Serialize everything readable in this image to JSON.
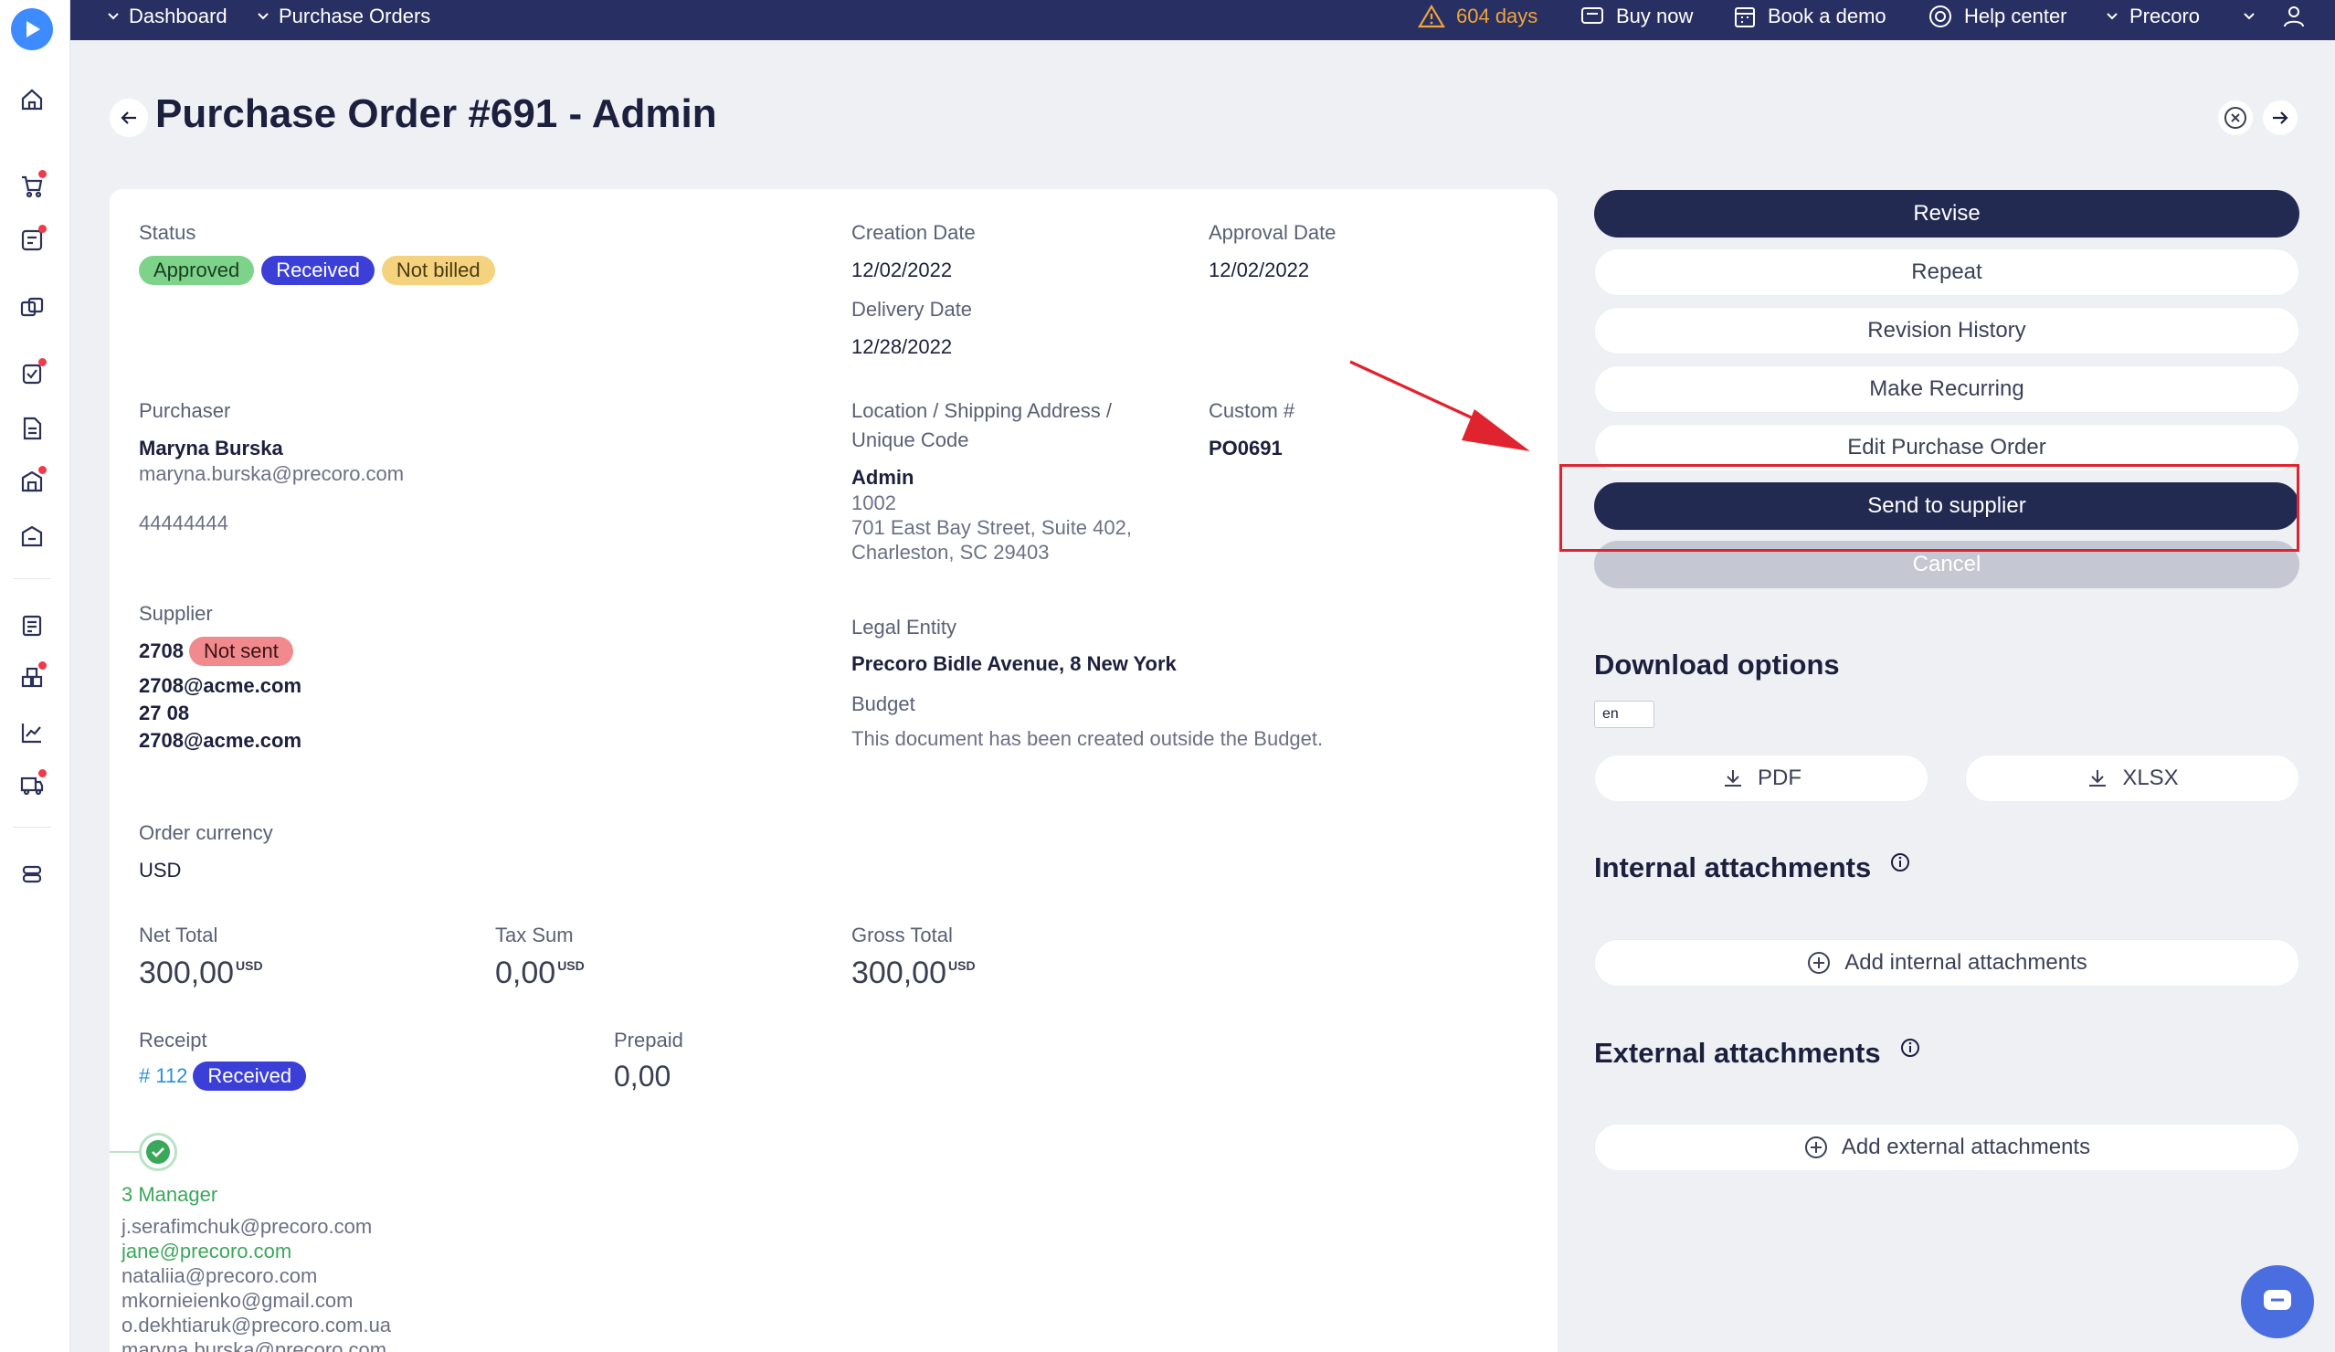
{
  "breadcrumbs": [
    "Dashboard",
    "Purchase Orders"
  ],
  "topbar": {
    "trial": "604 days",
    "buy_now": "Buy now",
    "book_demo": "Book a demo",
    "help_center": "Help center",
    "company": "Precoro"
  },
  "page": {
    "title": "Purchase Order #691 - Admin"
  },
  "details": {
    "status_label": "Status",
    "status_badges": [
      "Approved",
      "Received",
      "Not billed"
    ],
    "creation_date_label": "Creation Date",
    "creation_date": "12/02/2022",
    "approval_date_label": "Approval Date",
    "approval_date": "12/02/2022",
    "delivery_date_label": "Delivery Date",
    "delivery_date": "12/28/2022",
    "purchaser_label": "Purchaser",
    "purchaser_name": "Maryna Burska",
    "purchaser_email": "maryna.burska@precoro.com",
    "purchaser_phone": "44444444",
    "location_label_1": "Location / Shipping Address /",
    "location_label_2": "Unique Code",
    "location_name": "Admin",
    "location_code": "1002",
    "location_address_1": "701 East Bay Street, Suite 402,",
    "location_address_2": "Charleston, SC 29403",
    "custom_label": "Custom #",
    "custom_value": "PO0691",
    "supplier_label": "Supplier",
    "supplier_name": "2708",
    "supplier_badge": "Not sent",
    "supplier_email": "2708@acme.com",
    "supplier_contact": "27 08",
    "supplier_email_2": "2708@acme.com",
    "legal_entity_label": "Legal Entity",
    "legal_entity": "Precoro Bidle Avenue, 8 New York",
    "budget_label": "Budget",
    "budget_text": "This document has been created outside the Budget.",
    "currency_label": "Order currency",
    "currency": "USD",
    "net_total_label": "Net Total",
    "net_total": "300,00",
    "tax_sum_label": "Tax Sum",
    "tax_sum": "0,00",
    "gross_total_label": "Gross Total",
    "gross_total": "300,00",
    "currency_sup": "USD",
    "receipt_label": "Receipt",
    "receipt_number": "# 112",
    "receipt_badge": "Received",
    "prepaid_label": "Prepaid",
    "prepaid": "0,00"
  },
  "approval": {
    "step": "3 Manager",
    "emails": [
      "j.serafimchuk@precoro.com",
      "jane@precoro.com",
      "nataliia@precoro.com",
      "mkornieienko@gmail.com",
      "o.dekhtiaruk@precoro.com.ua",
      "maryna.burska@precoro.com"
    ]
  },
  "actions": {
    "revise": "Revise",
    "repeat": "Repeat",
    "revision_history": "Revision History",
    "make_recurring": "Make Recurring",
    "edit": "Edit Purchase Order",
    "send": "Send to supplier",
    "cancel": "Cancel"
  },
  "download": {
    "title": "Download options",
    "lang": "en",
    "pdf": "PDF",
    "xlsx": "XLSX"
  },
  "internal_attachments": {
    "title": "Internal attachments",
    "add": "Add internal attachments"
  },
  "external_attachments": {
    "title": "External attachments",
    "add": "Add external attachments"
  },
  "colors": {
    "topbar": "#283063",
    "primary_button": "#222a52",
    "highlight": "#e0242f",
    "approved": "#7dd38a",
    "received": "#3b3fd8",
    "not_billed": "#f5d27d",
    "not_sent": "#f08a8e"
  }
}
